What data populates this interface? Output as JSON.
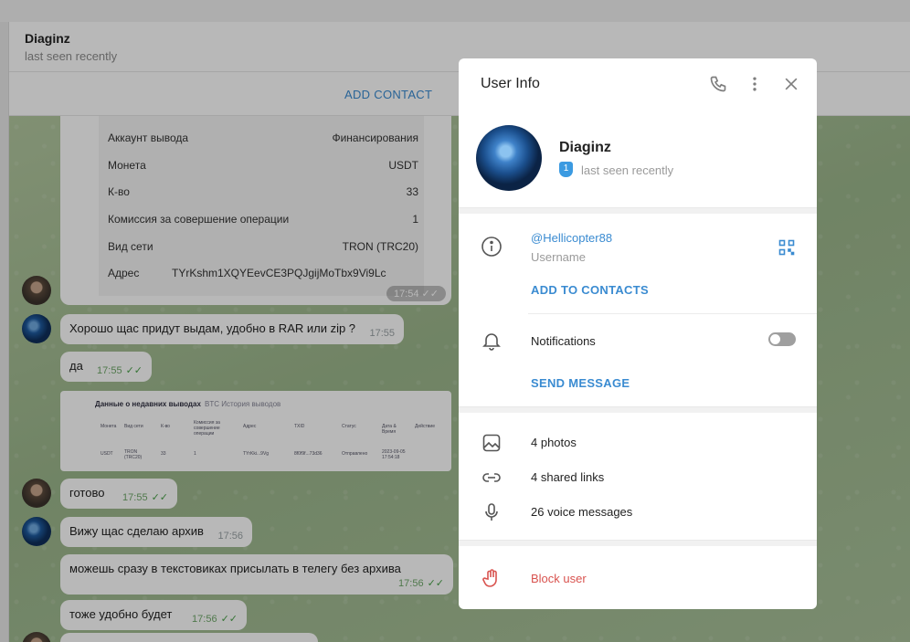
{
  "chat": {
    "contact_name": "Diaginz",
    "contact_status": "last seen recently",
    "add_contact_label": "ADD CONTACT"
  },
  "withdrawal_card": {
    "rows": [
      {
        "key": "Аккаунт вывода",
        "value": "Финансирования"
      },
      {
        "key": "Монета",
        "value": "USDT"
      },
      {
        "key": "К-во",
        "value": "33"
      },
      {
        "key": "Комиссия за совершение операции",
        "value": "1"
      },
      {
        "key": "Вид сети",
        "value": "TRON (TRC20)"
      }
    ],
    "address_key": "Адрес",
    "address_value": "TYrKshm1XQYEevCE3PQJgijMoTbx9Vi9Lc",
    "time": "17:54"
  },
  "messages": [
    {
      "text": "Хорошо щас придут выдам, удобно в RAR или zip ?",
      "time": "17:55"
    },
    {
      "text": "да",
      "time": "17:55"
    },
    {
      "text": "готово",
      "time": "17:55"
    },
    {
      "text": "Вижу щас сделаю архив",
      "time": "17:56"
    },
    {
      "text": "можешь сразу в текстовиках присылать в телегу без архива",
      "time": "17:56"
    },
    {
      "text": "тоже удобно будет",
      "time": "17:56"
    }
  ],
  "screenshot_card": {
    "title": "Данные о недавних выводах",
    "subtitle": "BTC История выводов",
    "headers": [
      "Монета",
      "Вид сети",
      "К-во",
      "Комиссия за совершение операции",
      "Адрес",
      "TXID",
      "Статус",
      "Дата & Время",
      "Действие"
    ],
    "cells": [
      "USDT",
      "TRON (TRC20)",
      "33",
      "1",
      "TYrKki...9Vg",
      "8f0f9f...73d36",
      "Отправлено",
      "2023-09-05 17:54:18",
      ""
    ]
  },
  "user_info": {
    "title": "User Info",
    "name": "Diaginz",
    "badge": "1",
    "status": "last seen recently",
    "username": "@Hellicopter88",
    "username_label": "Username",
    "add_to_contacts": "ADD TO CONTACTS",
    "notifications_label": "Notifications",
    "notifications_on": false,
    "send_message": "SEND MESSAGE",
    "media": [
      {
        "icon": "photo-icon",
        "label": "4 photos"
      },
      {
        "icon": "link-icon",
        "label": "4 shared links"
      },
      {
        "icon": "microphone-icon",
        "label": "26 voice messages"
      }
    ],
    "block_user": "Block user"
  },
  "colors": {
    "accent": "#3a8bd1",
    "danger": "#d9534f",
    "check": "#4aa14a"
  }
}
